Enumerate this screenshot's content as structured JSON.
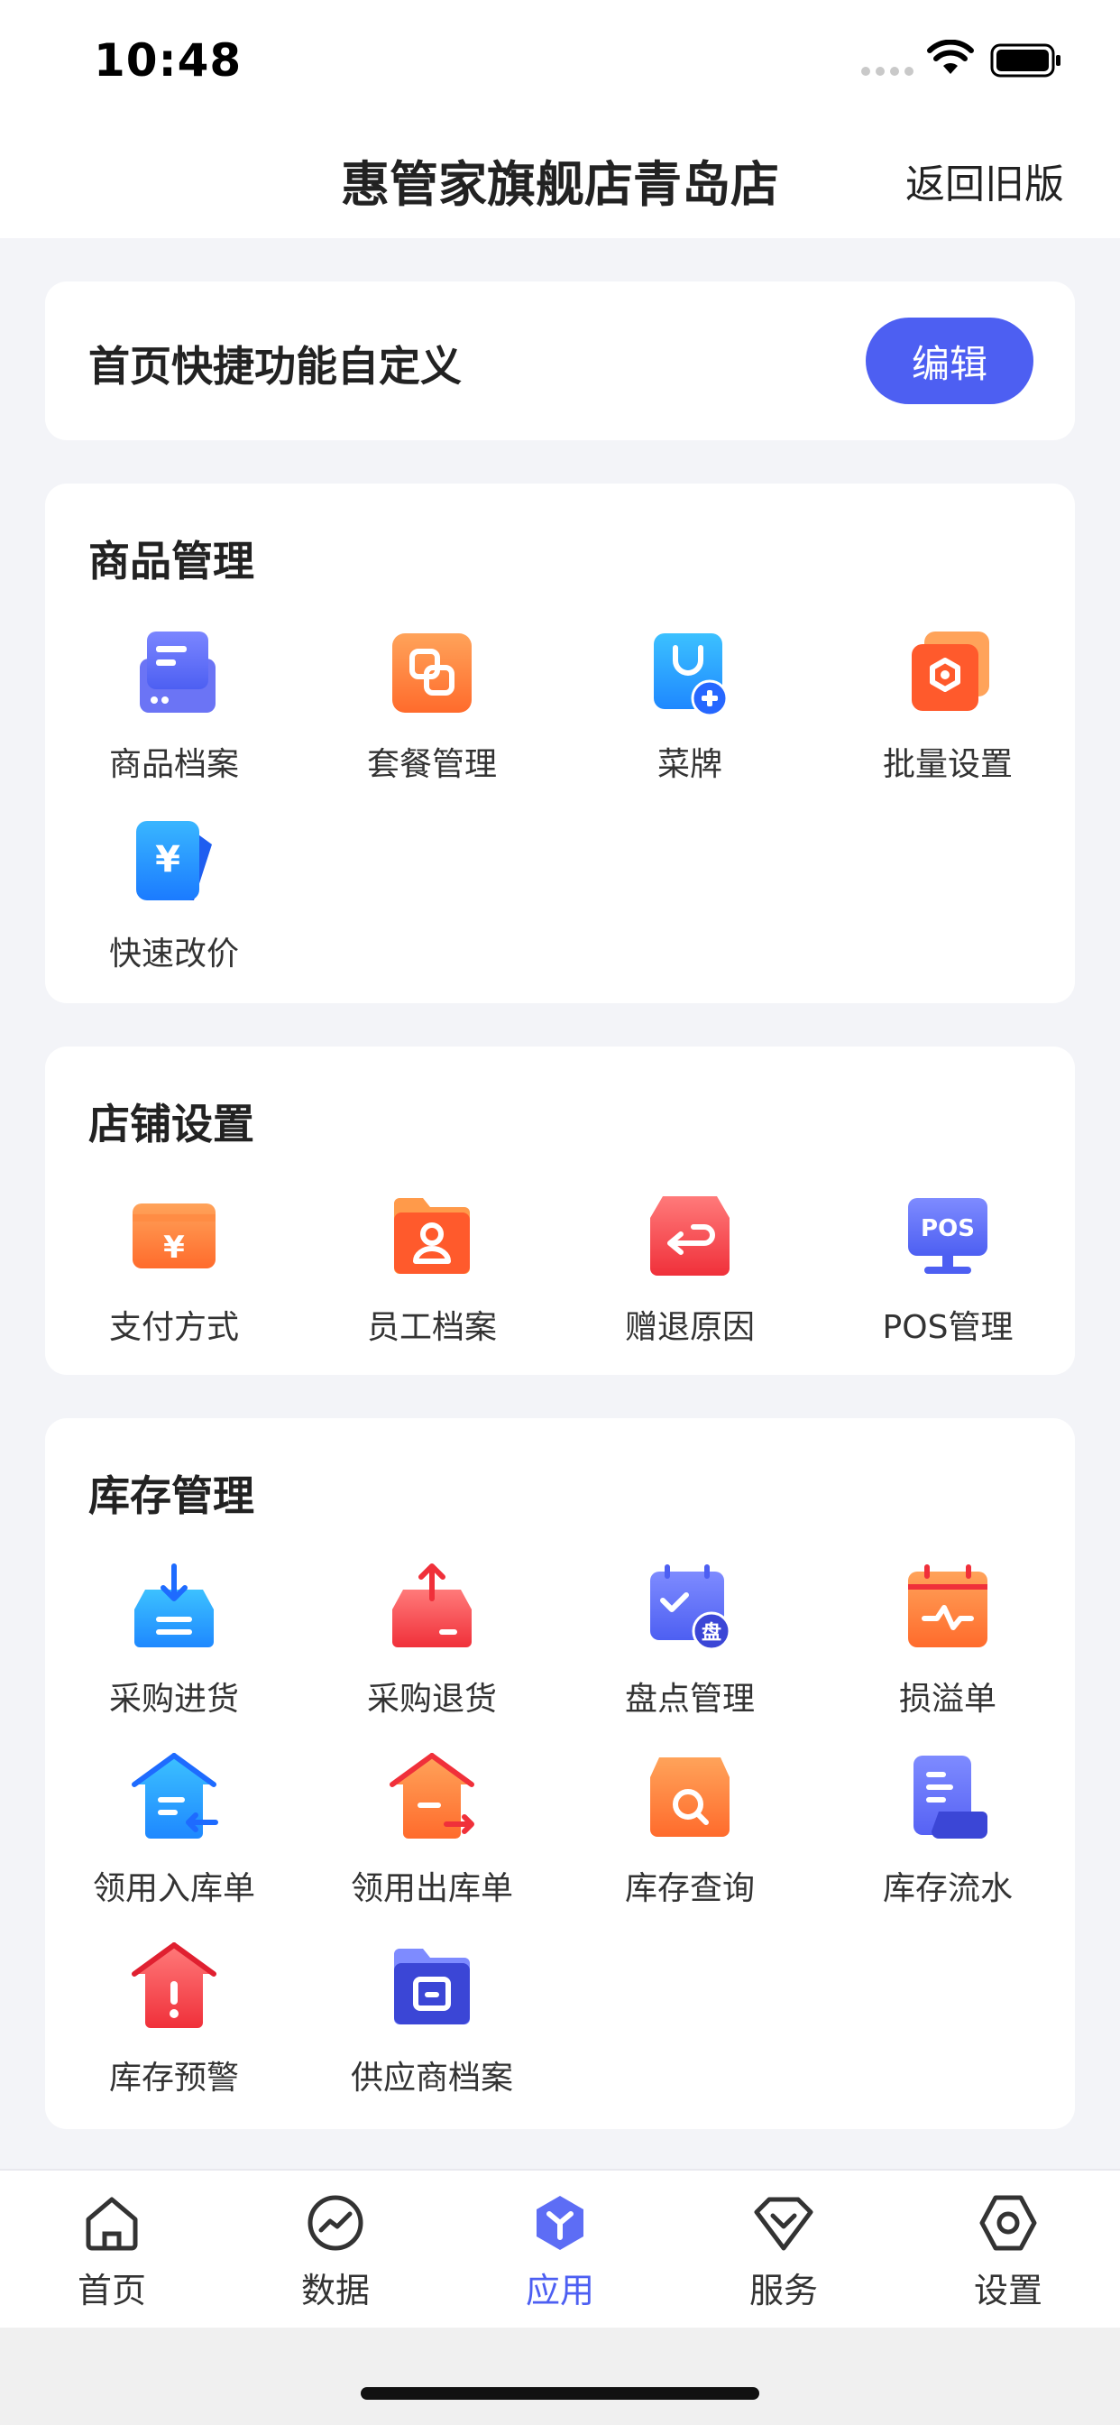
{
  "status": {
    "time": "10:48"
  },
  "nav": {
    "title": "惠管家旗舰店青岛店",
    "back_label": "返回旧版"
  },
  "quick": {
    "title": "首页快捷功能自定义",
    "edit_label": "编辑"
  },
  "sections": {
    "goods": {
      "title": "商品管理",
      "items": [
        {
          "label": "商品档案",
          "icon": "goods-archive-icon"
        },
        {
          "label": "套餐管理",
          "icon": "combo-icon"
        },
        {
          "label": "菜牌",
          "icon": "menu-card-icon"
        },
        {
          "label": "批量设置",
          "icon": "batch-settings-icon"
        },
        {
          "label": "快速改价",
          "icon": "quick-price-icon"
        }
      ]
    },
    "store": {
      "title": "店铺设置",
      "items": [
        {
          "label": "支付方式",
          "icon": "payment-icon"
        },
        {
          "label": "员工档案",
          "icon": "staff-icon"
        },
        {
          "label": "赠退原因",
          "icon": "return-reason-icon"
        },
        {
          "label": "POS管理",
          "icon": "pos-icon",
          "icon_text": "POS"
        }
      ]
    },
    "stock": {
      "title": "库存管理",
      "items": [
        {
          "label": "采购进货",
          "icon": "purchase-in-icon"
        },
        {
          "label": "采购退货",
          "icon": "purchase-return-icon"
        },
        {
          "label": "盘点管理",
          "icon": "inventory-check-icon",
          "icon_text": "盘"
        },
        {
          "label": "损溢单",
          "icon": "loss-gain-icon"
        },
        {
          "label": "领用入库单",
          "icon": "stock-in-icon"
        },
        {
          "label": "领用出库单",
          "icon": "stock-out-icon"
        },
        {
          "label": "库存查询",
          "icon": "stock-query-icon"
        },
        {
          "label": "库存流水",
          "icon": "stock-flow-icon"
        },
        {
          "label": "库存预警",
          "icon": "stock-warning-icon"
        },
        {
          "label": "供应商档案",
          "icon": "supplier-icon"
        }
      ]
    }
  },
  "tabs": [
    {
      "label": "首页",
      "icon": "home-icon"
    },
    {
      "label": "数据",
      "icon": "data-icon"
    },
    {
      "label": "应用",
      "icon": "apps-icon",
      "active": true
    },
    {
      "label": "服务",
      "icon": "service-icon"
    },
    {
      "label": "设置",
      "icon": "settings-icon"
    }
  ],
  "colors": {
    "accent": "#4d5ff2",
    "background": "#f3f4f8"
  }
}
